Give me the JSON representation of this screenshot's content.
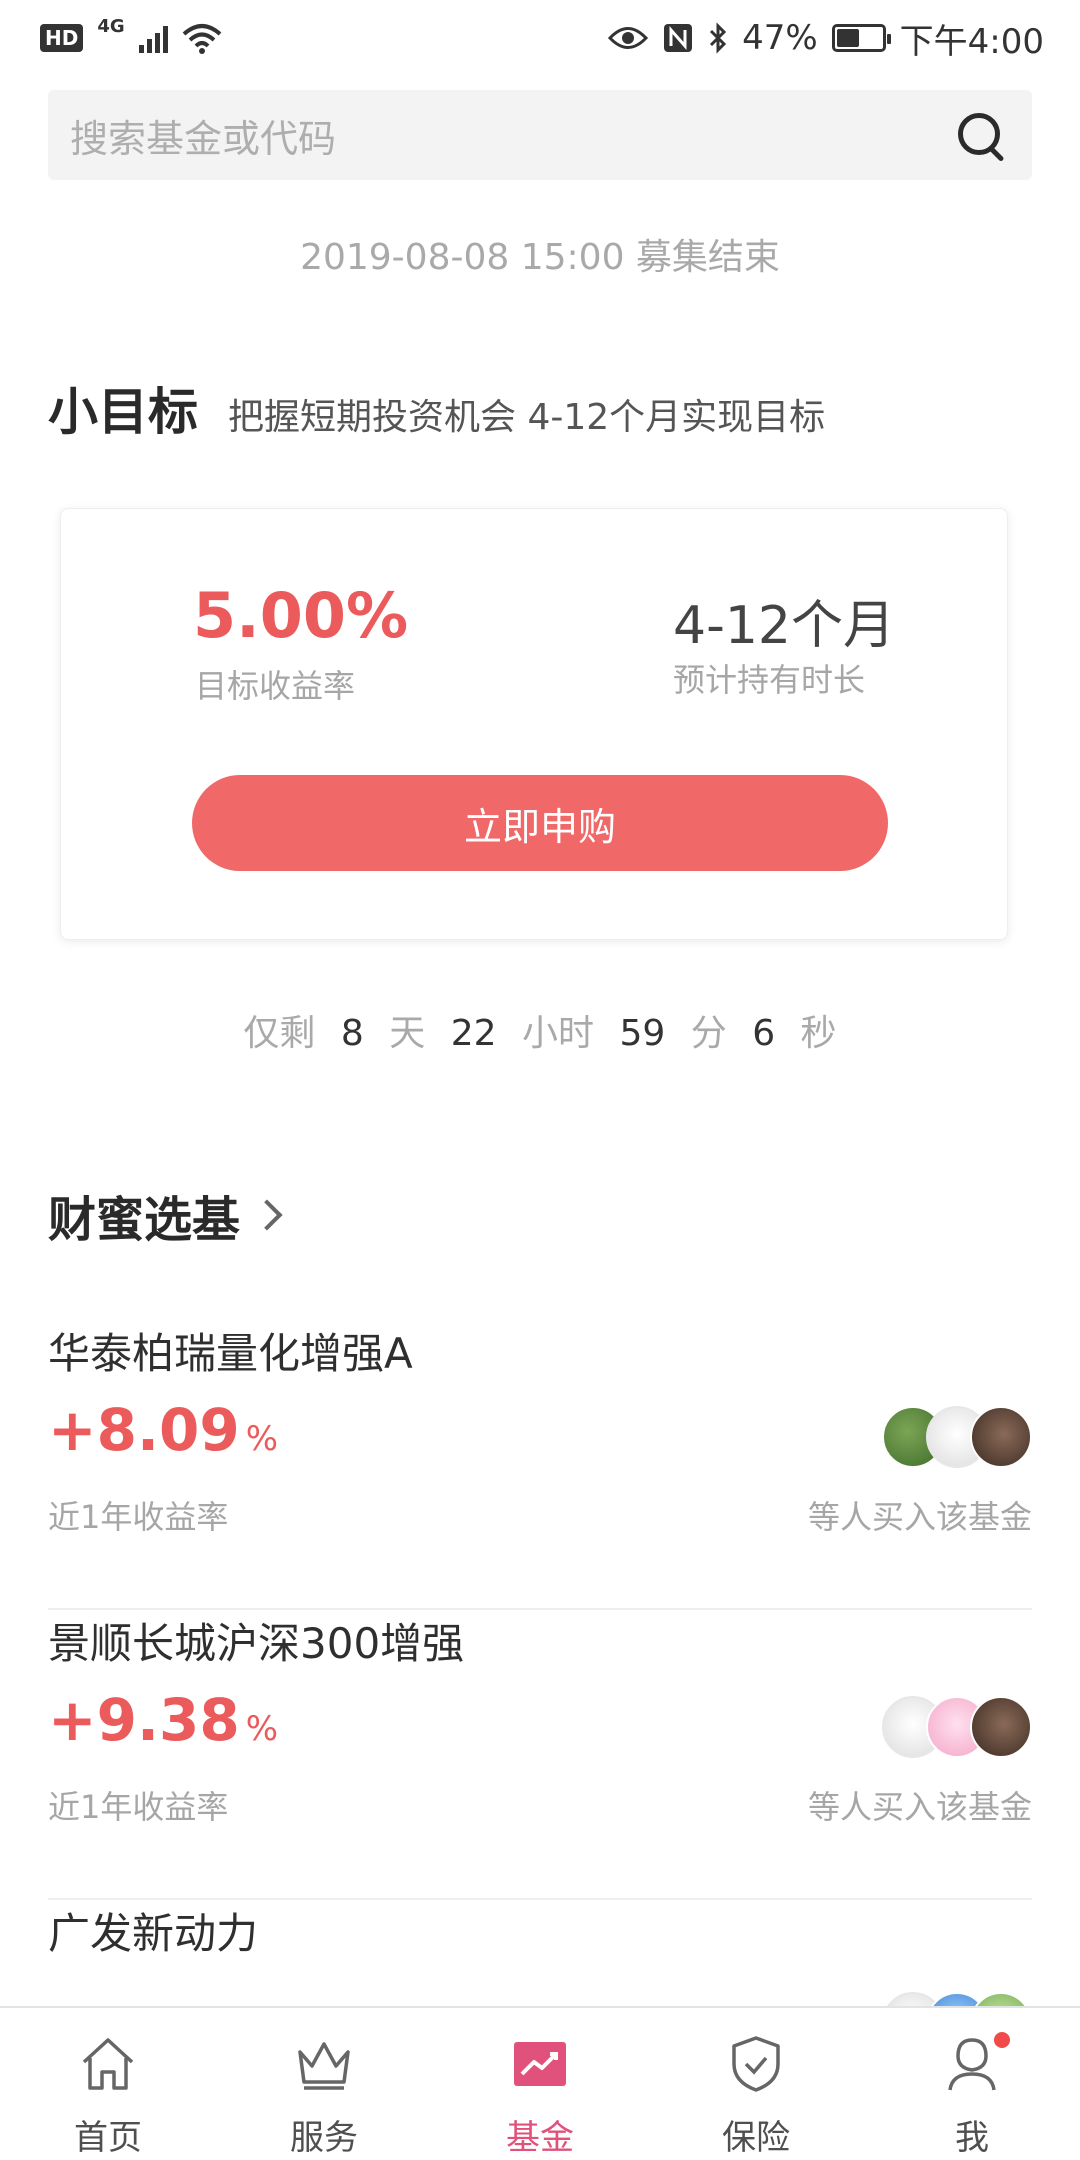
{
  "status_bar": {
    "hd": "HD",
    "network": "4G",
    "battery": "47%",
    "time": "下午4:00"
  },
  "search": {
    "placeholder": "搜索基金或代码"
  },
  "raise_end": "2019-08-08 15:00 募集结束",
  "goal": {
    "title": "小目标",
    "subtitle": "把握短期投资机会 4-12个月实现目标",
    "rate_value": "5.00%",
    "rate_label": "目标收益率",
    "duration_value": "4-12个月",
    "duration_label": "预计持有时长",
    "buy_label": "立即申购"
  },
  "countdown": {
    "prefix": "仅剩",
    "days": "8",
    "days_unit": "天",
    "hours": "22",
    "hours_unit": "小时",
    "minutes": "59",
    "minutes_unit": "分",
    "seconds": "6",
    "seconds_unit": "秒"
  },
  "picks": {
    "title": "财蜜选基",
    "funds": [
      {
        "name": "华泰柏瑞量化增强A",
        "rate": "+8.09",
        "pct": "%",
        "rate_label": "近1年收益率",
        "buyers_label": "等人买入该基金"
      },
      {
        "name": "景顺长城沪深300增强",
        "rate": "+9.38",
        "pct": "%",
        "rate_label": "近1年收益率",
        "buyers_label": "等人买入该基金"
      },
      {
        "name": "广发新动力"
      }
    ]
  },
  "tabbar": {
    "items": [
      {
        "label": "首页",
        "icon": "home-icon"
      },
      {
        "label": "服务",
        "icon": "crown-icon"
      },
      {
        "label": "基金",
        "icon": "fund-chart-icon",
        "active": true
      },
      {
        "label": "保险",
        "icon": "shield-check-icon"
      },
      {
        "label": "我",
        "icon": "user-icon",
        "badge": true
      }
    ]
  },
  "colors": {
    "accent_red": "#f06868",
    "rate_red": "#ec5b5b",
    "active_tab": "#e0527b"
  }
}
